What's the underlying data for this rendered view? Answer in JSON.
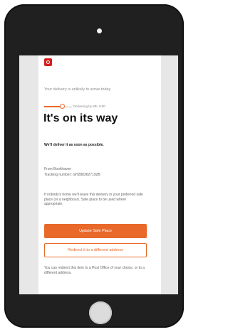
{
  "email": {
    "intro": "Your delivery is unlikely to arrive today",
    "progress_label": "Delivering by 9th, 9:00",
    "headline": "It's on its way",
    "subline": "We'll deliver it as soon as possible.",
    "from": "From Bookhaven",
    "tracking": "Tracking number: GH2883627192B",
    "note": "If nobody's home we'll leave this delivery in your preferred safe place (or a neighbour). Safe place to be used where appropriate.",
    "primary_button": "Update Safe Place",
    "secondary_button": "Redirect it to a different address",
    "footer": "You can redirect this item to a Post Office of your choice, or to a different address."
  },
  "colors": {
    "accent": "#e8692a",
    "logo": "#d42020",
    "device": "#202020"
  }
}
